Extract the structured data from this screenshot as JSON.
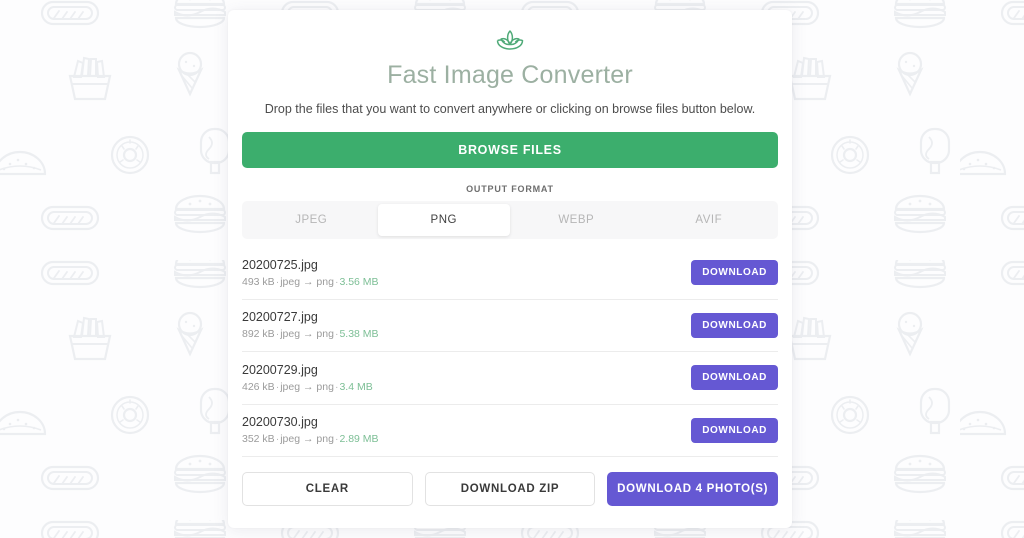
{
  "app": {
    "logo_icon": "lotus-icon",
    "title": "Fast Image Converter",
    "drop_hint": "Drop the files that you want to convert anywhere or clicking on browse files button below.",
    "browse_label": "BROWSE FILES"
  },
  "output_format": {
    "label": "OUTPUT FORMAT",
    "selected": "PNG",
    "options": [
      "JPEG",
      "PNG",
      "WEBP",
      "AVIF"
    ]
  },
  "files": [
    {
      "name": "20200725.jpg",
      "input_size": "493 kB",
      "from_format": "jpeg",
      "arrow": "→",
      "to_format": "png",
      "output_size": "3.56 MB",
      "download_label": "DOWNLOAD"
    },
    {
      "name": "20200727.jpg",
      "input_size": "892 kB",
      "from_format": "jpeg",
      "arrow": "→",
      "to_format": "png",
      "output_size": "5.38 MB",
      "download_label": "DOWNLOAD"
    },
    {
      "name": "20200729.jpg",
      "input_size": "426 kB",
      "from_format": "jpeg",
      "arrow": "→",
      "to_format": "png",
      "output_size": "3.4 MB",
      "download_label": "DOWNLOAD"
    },
    {
      "name": "20200730.jpg",
      "input_size": "352 kB",
      "from_format": "jpeg",
      "arrow": "→",
      "to_format": "png",
      "output_size": "2.89 MB",
      "download_label": "DOWNLOAD"
    }
  ],
  "actions": {
    "clear_label": "CLEAR",
    "download_zip_label": "DOWNLOAD ZIP",
    "download_all_label": "DOWNLOAD 4 PHOTO(S)"
  },
  "separators": {
    "dot": "·"
  },
  "colors": {
    "green": "#3cae6d",
    "purple": "#6558d3",
    "title": "#9cb0a2",
    "output_size": "#7dbf96"
  },
  "background": {
    "pattern_icons": [
      "hotdog-icon",
      "burger-icon",
      "fries-icon",
      "ice-cream-cone-icon",
      "soda-cup-icon",
      "donut-icon",
      "taco-icon",
      "popsicle-icon"
    ],
    "pattern_color": "#eff0f3"
  }
}
